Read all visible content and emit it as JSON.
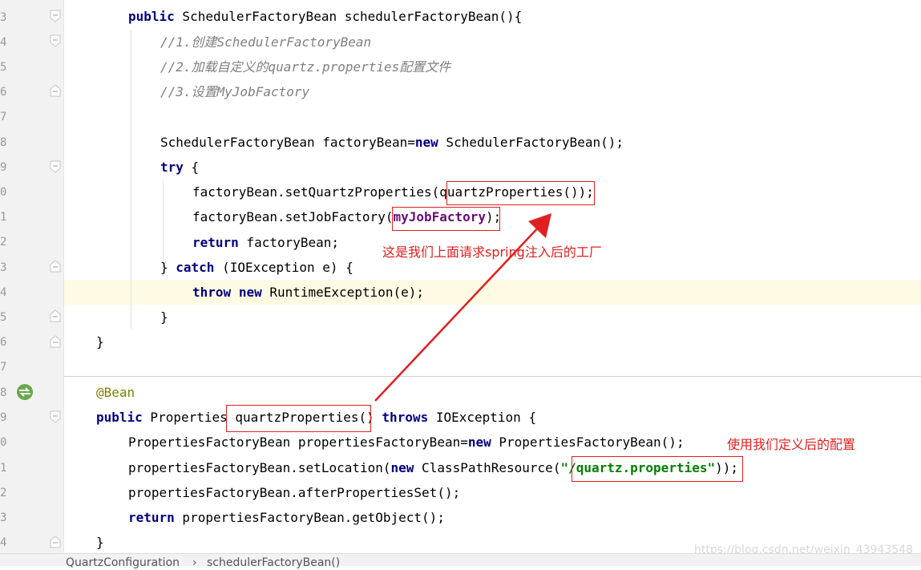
{
  "gutter": {
    "line_numbers": [
      "3",
      "4",
      "5",
      "6",
      "7",
      "8",
      "9",
      "0",
      "1",
      "2",
      "3",
      "4",
      "5",
      "6",
      "7",
      "8",
      "9",
      "0",
      "1",
      "2",
      "3",
      "4"
    ]
  },
  "code": {
    "l1_kw": "public",
    "l1_rest": " SchedulerFactoryBean schedulerFactoryBean(){",
    "l2": "//1.创建SchedulerFactoryBean",
    "l3": "//2.加载自定义的quartz.properties配置文件",
    "l4": "//3.设置MyJobFactory",
    "l6_a": "SchedulerFactoryBean factoryBean=",
    "l6_kw": "new",
    "l6_b": " SchedulerFactoryBean();",
    "l7_kw": "try",
    "l7_rest": " {",
    "l8_a": "factoryBean.setQuartzProperties(quartzProperties());",
    "l9_a": "factoryBean.setJobFactory(",
    "l9_field": "myJobFactory",
    "l9_b": ");",
    "l10_kw": "return",
    "l10_rest": " factoryBean;",
    "l11_a": "} ",
    "l11_kw": "catch",
    "l11_b": " (IOException e) {",
    "l12_kw1": "throw",
    "l12_sp": " ",
    "l12_kw2": "new",
    "l12_rest": " RuntimeException(e);",
    "l13": "}",
    "l14": "}",
    "l16": "@Bean",
    "l17_kw": "public",
    "l17_a": " Properties quartzProperties() ",
    "l17_kw2": "throws",
    "l17_b": " IOException {",
    "l18_a": "PropertiesFactoryBean propertiesFactoryBean=",
    "l18_kw": "new",
    "l18_b": " PropertiesFactoryBean();",
    "l19_a": "propertiesFactoryBean.setLocation(",
    "l19_kw": "new",
    "l19_b": " ClassPathResource(",
    "l19_str": "\"/quartz.properties\"",
    "l19_c": "));",
    "l20": "propertiesFactoryBean.afterPropertiesSet();",
    "l21_kw": "return",
    "l21_rest": " propertiesFactoryBean.getObject();",
    "l22": "}"
  },
  "annotations": {
    "note_factory": "这是我们上面请求spring注入后的工厂",
    "note_config": "使用我们定义后的配置"
  },
  "status_bar": {
    "crumb_1": "QuartzConfiguration",
    "crumb_sep": "›",
    "crumb_2": "schedulerFactoryBean()"
  },
  "watermark": "https://blog.csdn.net/weixin_43943548",
  "colors": {
    "keyword": "#000080",
    "comment": "#808080",
    "annotation": "#808000",
    "field": "#660e7a",
    "string": "#008000",
    "markup_red": "#e02020",
    "caret_line": "#fffae3"
  },
  "icons": {
    "bean_gutter": "spring-bean-icon",
    "fold": "fold-marker-icon"
  }
}
